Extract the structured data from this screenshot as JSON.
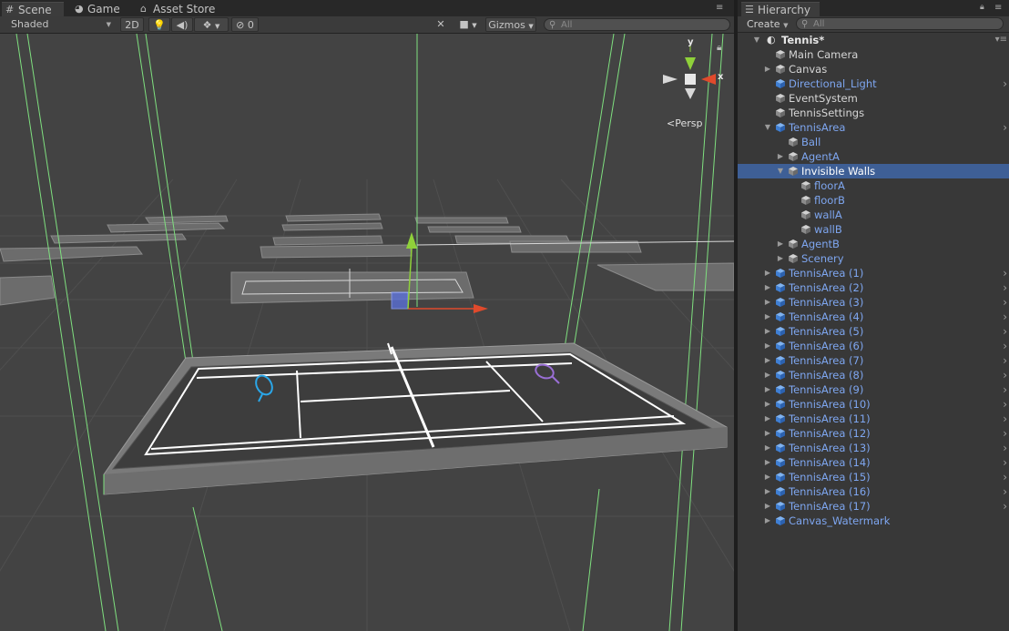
{
  "tabs": {
    "scene": "Scene",
    "game": "Game",
    "asset_store": "Asset Store",
    "hierarchy": "Hierarchy"
  },
  "scene_toolbar": {
    "draw_mode": "Shaded",
    "mode_2d": "2D",
    "hidden_count": "0",
    "gizmos": "Gizmos",
    "search_placeholder": "All"
  },
  "viewport": {
    "projection_label": "Persp",
    "axis_y": "y",
    "axis_x": "x"
  },
  "hierarchy": {
    "create_label": "Create",
    "search_placeholder": "All",
    "scene_name": "Tennis*",
    "items": [
      {
        "label": "Main Camera",
        "depth": 1,
        "expander": "none",
        "prefab": false,
        "icon": "gameobject-icon"
      },
      {
        "label": "Canvas",
        "depth": 1,
        "expander": "collapsed",
        "prefab": false,
        "icon": "gameobject-icon"
      },
      {
        "label": "Directional_Light",
        "depth": 1,
        "expander": "none",
        "prefab": true,
        "icon": "prefab-icon",
        "more": true
      },
      {
        "label": "EventSystem",
        "depth": 1,
        "expander": "none",
        "prefab": false,
        "icon": "gameobject-icon"
      },
      {
        "label": "TennisSettings",
        "depth": 1,
        "expander": "none",
        "prefab": false,
        "icon": "gameobject-icon"
      },
      {
        "label": "TennisArea",
        "depth": 1,
        "expander": "expanded",
        "prefab": true,
        "icon": "prefab-icon",
        "more": true
      },
      {
        "label": "Ball",
        "depth": 2,
        "expander": "none",
        "prefab": true,
        "icon": "gameobject-icon"
      },
      {
        "label": "AgentA",
        "depth": 2,
        "expander": "collapsed",
        "prefab": true,
        "icon": "gameobject-icon"
      },
      {
        "label": "Invisible Walls",
        "depth": 2,
        "expander": "expanded",
        "prefab": false,
        "icon": "gameobject-icon",
        "selected": true
      },
      {
        "label": "floorA",
        "depth": 3,
        "expander": "none",
        "prefab": true,
        "icon": "gameobject-icon"
      },
      {
        "label": "floorB",
        "depth": 3,
        "expander": "none",
        "prefab": true,
        "icon": "gameobject-icon"
      },
      {
        "label": "wallA",
        "depth": 3,
        "expander": "none",
        "prefab": true,
        "icon": "gameobject-icon"
      },
      {
        "label": "wallB",
        "depth": 3,
        "expander": "none",
        "prefab": true,
        "icon": "gameobject-icon"
      },
      {
        "label": "AgentB",
        "depth": 2,
        "expander": "collapsed",
        "prefab": true,
        "icon": "gameobject-icon"
      },
      {
        "label": "Scenery",
        "depth": 2,
        "expander": "collapsed",
        "prefab": true,
        "icon": "gameobject-icon"
      },
      {
        "label": "TennisArea (1)",
        "depth": 1,
        "expander": "collapsed",
        "prefab": true,
        "icon": "prefab-icon",
        "more": true
      },
      {
        "label": "TennisArea (2)",
        "depth": 1,
        "expander": "collapsed",
        "prefab": true,
        "icon": "prefab-icon",
        "more": true
      },
      {
        "label": "TennisArea (3)",
        "depth": 1,
        "expander": "collapsed",
        "prefab": true,
        "icon": "prefab-icon",
        "more": true
      },
      {
        "label": "TennisArea (4)",
        "depth": 1,
        "expander": "collapsed",
        "prefab": true,
        "icon": "prefab-icon",
        "more": true
      },
      {
        "label": "TennisArea (5)",
        "depth": 1,
        "expander": "collapsed",
        "prefab": true,
        "icon": "prefab-icon",
        "more": true
      },
      {
        "label": "TennisArea (6)",
        "depth": 1,
        "expander": "collapsed",
        "prefab": true,
        "icon": "prefab-icon",
        "more": true
      },
      {
        "label": "TennisArea (7)",
        "depth": 1,
        "expander": "collapsed",
        "prefab": true,
        "icon": "prefab-icon",
        "more": true
      },
      {
        "label": "TennisArea (8)",
        "depth": 1,
        "expander": "collapsed",
        "prefab": true,
        "icon": "prefab-icon",
        "more": true
      },
      {
        "label": "TennisArea (9)",
        "depth": 1,
        "expander": "collapsed",
        "prefab": true,
        "icon": "prefab-icon",
        "more": true
      },
      {
        "label": "TennisArea (10)",
        "depth": 1,
        "expander": "collapsed",
        "prefab": true,
        "icon": "prefab-icon",
        "more": true
      },
      {
        "label": "TennisArea (11)",
        "depth": 1,
        "expander": "collapsed",
        "prefab": true,
        "icon": "prefab-icon",
        "more": true
      },
      {
        "label": "TennisArea (12)",
        "depth": 1,
        "expander": "collapsed",
        "prefab": true,
        "icon": "prefab-icon",
        "more": true
      },
      {
        "label": "TennisArea (13)",
        "depth": 1,
        "expander": "collapsed",
        "prefab": true,
        "icon": "prefab-icon",
        "more": true
      },
      {
        "label": "TennisArea (14)",
        "depth": 1,
        "expander": "collapsed",
        "prefab": true,
        "icon": "prefab-icon",
        "more": true
      },
      {
        "label": "TennisArea (15)",
        "depth": 1,
        "expander": "collapsed",
        "prefab": true,
        "icon": "prefab-icon",
        "more": true
      },
      {
        "label": "TennisArea (16)",
        "depth": 1,
        "expander": "collapsed",
        "prefab": true,
        "icon": "prefab-icon",
        "more": true
      },
      {
        "label": "TennisArea (17)",
        "depth": 1,
        "expander": "collapsed",
        "prefab": true,
        "icon": "prefab-icon",
        "more": true
      },
      {
        "label": "Canvas_Watermark",
        "depth": 1,
        "expander": "collapsed",
        "prefab": true,
        "icon": "prefab-icon"
      }
    ]
  },
  "colors": {
    "selection": "#3e5f96",
    "prefab_text": "#7ea6f0",
    "agent_a_racket": "#2aa6e8",
    "agent_b_racket": "#9a6fd6",
    "wall_outline": "#7fe07f",
    "axis_x": "#e04a2c",
    "axis_y": "#8fd13a"
  }
}
